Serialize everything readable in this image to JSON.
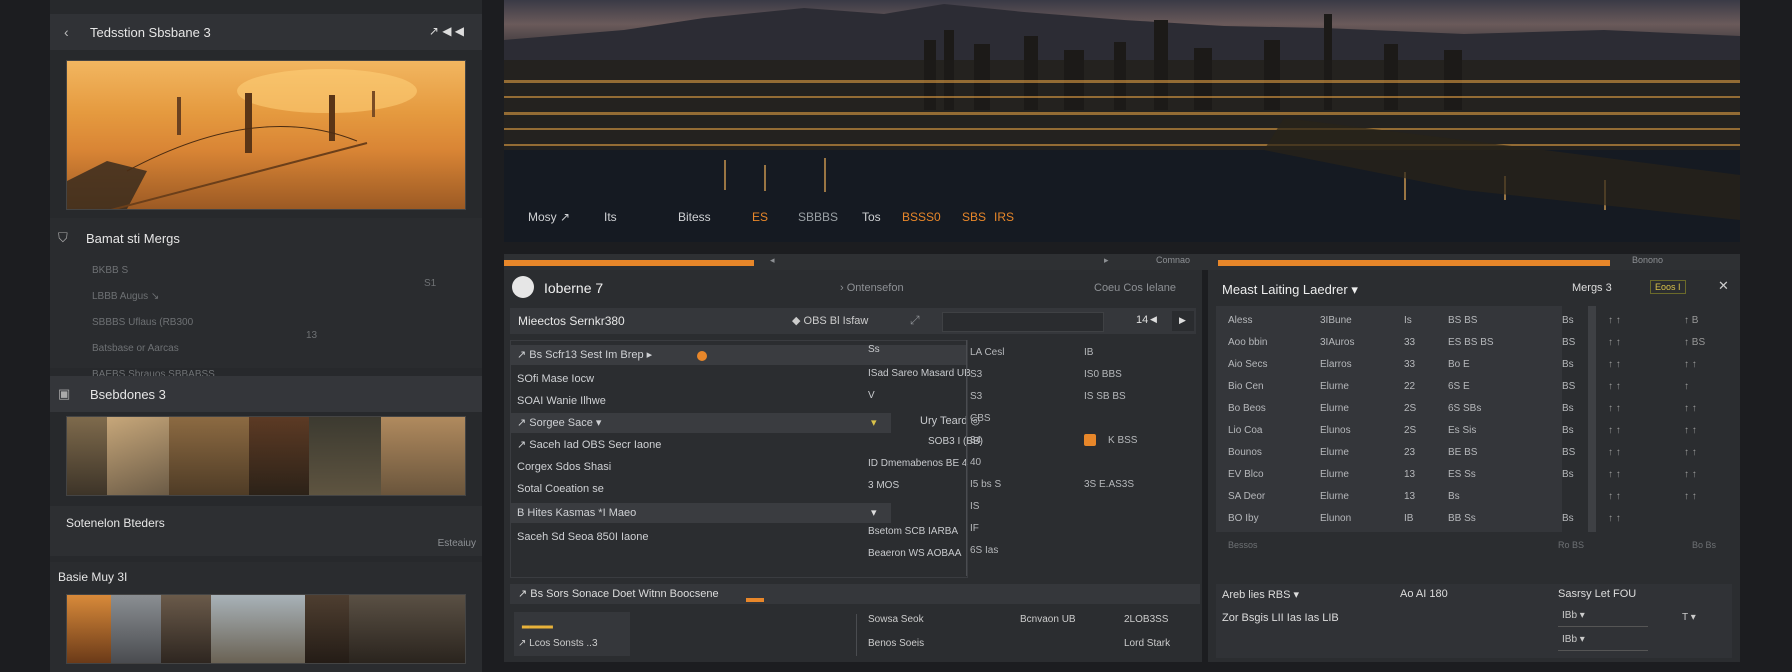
{
  "left": {
    "header1": "Tedsstion Sbsbane 3",
    "header1_icons": "↗ ◀ ◀",
    "section2_title": "Bamat sti Mergs",
    "section2_rows": [
      {
        "a": "BKBB  S",
        "b": ""
      },
      {
        "a": "LBBB Augus ↘",
        "b": "S                                           S1"
      },
      {
        "a": "SBBBS Uflaus (RB300",
        "b": ""
      },
      {
        "a": "Batsbase or Aarcas",
        "b": "13"
      },
      {
        "a": "BAEBS Sbrauos  SBBABSS",
        "b": ""
      }
    ],
    "section3_title": "Bsebdones 3",
    "section4_title": "Sotenelon Bteders",
    "section4_link": "Esteaiuy",
    "section5_title": "Basie Muy 3I"
  },
  "hero": {
    "labels": [
      {
        "text": "Mosy ↗",
        "color": "#e6e6e6"
      },
      {
        "text": "Its",
        "color": "#e6e6e6"
      },
      {
        "text": "Bitess",
        "color": "#e6e6e6"
      },
      {
        "text": "ES",
        "color": "#e8872a"
      },
      {
        "text": "SBBBS",
        "color": "#9aa0a4"
      },
      {
        "text": "Tos",
        "color": "#e6e6e6"
      },
      {
        "text": "BSSS0",
        "color": "#e8872a"
      },
      {
        "text": "SBS",
        "color": "#e8872a"
      },
      {
        "text": "IRS",
        "color": "#e8872a"
      }
    ],
    "bar_left": "◂",
    "bar_mid": "▸",
    "bar_right_a": "Comnao",
    "bar_right_b": "Bonono"
  },
  "mid": {
    "title": "Ioberne 7",
    "title_right_a": "› Ontensefon",
    "title_right_b": "Coeu  Cos Ielane",
    "toolbar_label": "Mieectos Sernkr380",
    "toolbar_mid": "◆ OBS  Bl Isfaw",
    "toolbar_icon": "⤢",
    "pager_num": "14",
    "rows": [
      {
        "left": "↗ Bs Scfr13  Sest Im Brep  ▸",
        "c2": "Ss",
        "c3": "LA  Ceal",
        "c4": "IB",
        "hl": true,
        "dot": true
      },
      {
        "left": "   SOfi Mase  Iocw",
        "c2": "ISad Sareo    Masard UB",
        "c3": "",
        "c4": "",
        "hl": false
      },
      {
        "left": "   SOAI Wanie  Ilhwe",
        "c2": "V",
        "c3": "",
        "c4": "",
        "hl": false
      },
      {
        "left": "↗ Sorgee Sace  ▾",
        "c2": "Ury  Teard  ◎",
        "c3": "",
        "c4": "",
        "hl": true
      },
      {
        "left": "↗ Saceh  Iad  OBS  Secr  Iaone",
        "c2": "SOB3 I  (BB)",
        "c3": "",
        "c4": "",
        "hl": false
      },
      {
        "left": "   Corgex Sdos Shasi",
        "c2": "ID Dmemabenos   BE  4",
        "c3": "",
        "c4": "",
        "hl": false
      },
      {
        "left": "   Sotal  Coeation se",
        "c2": "3  MOS",
        "c3": "",
        "c4": "",
        "hl": false
      },
      {
        "left": "B Hites Kasmas  *I Maeo",
        "c2": "",
        "c3": "",
        "c4": "",
        "hl": true
      },
      {
        "left": "   Saceh Sd Seoa 850I Iaone",
        "c2": "Bsetom     SCB IARBA",
        "c3": "",
        "c4": "",
        "hl": false
      },
      {
        "left": "",
        "c2": "Beaeron     WS  AOBAA",
        "c3": "",
        "c4": "",
        "hl": false
      }
    ],
    "col3": [
      "LA  Cesl",
      "S3",
      "S3",
      "CBS",
      "34",
      "40",
      "I5 bs  S",
      "IS",
      "IF",
      "6S  Ias"
    ],
    "col4": [
      "IB",
      "IS0  BBS",
      "IS  SB  BS",
      "",
      "",
      "",
      "3S  E.AS3S",
      "",
      "",
      ""
    ],
    "col4b": [
      "",
      "",
      "",
      "",
      "K BSS",
      "",
      "",
      "",
      "",
      ""
    ],
    "footer_row": "↗ Bs Sors Sonace  Doet  Witnn  Boocsene",
    "bottom_left_a": "▂▂▂▂",
    "bottom_left_b": "↗ Lcos Sonsts  ..3",
    "bottom_mid_a": "Sowsa  Seok",
    "bottom_mid_b": "Benos  Soeis",
    "bottom_right_a": "Bcnvaon  UB",
    "bottom_right_b": "Lord  Stark",
    "bottom_far_a": "2LOB3SS",
    "bottom_far_b": ""
  },
  "rightp": {
    "title": "Meast Laiting  Laedrer ▾",
    "title_right": "Mergs 3",
    "badge": "Eoos  I",
    "close": "✕",
    "tbl_c1": [
      "Aless",
      "Aoo bbin",
      "Aio Secs",
      "Bio Cen",
      "Bo Beos",
      "Lio Coa",
      "Bounos",
      "EV Blco",
      "SA Deor",
      "BO Iby"
    ],
    "tbl_c2": [
      "3IBune",
      "3IAuros",
      "Elarros",
      "Elurne",
      "Elurne",
      "Elunos",
      "Elurne",
      "Elurne",
      "Elurne",
      "Elunon"
    ],
    "tbl_c3": [
      "Is",
      "33",
      "33",
      "22",
      "2S",
      "2S",
      "23",
      "13",
      "13",
      "IB"
    ],
    "tbl_c4": [
      "BS  BS",
      "ES  BS  BS",
      "Bo  E",
      "6S  E",
      "6S  SBs",
      "Es  Sis",
      "BE  BS",
      "ES  Ss",
      "Bs",
      "BB  Ss"
    ],
    "tbl_c5": [
      "Bs",
      "BS",
      "Bs",
      "BS",
      "Bs",
      "Bs",
      "BS",
      "Bs",
      "",
      "Bs"
    ],
    "tbl_c6": [
      "↑  ↑",
      "↑  ↑",
      "↑  ↑",
      "↑  ↑",
      "↑  ↑",
      "↑  ↑",
      "↑  ↑",
      "↑  ↑",
      "↑  ↑",
      "↑  ↑"
    ],
    "tbl_c7": [
      "↑  B",
      "↑  BS",
      "↑  ↑",
      "↑",
      "↑  ↑",
      "↑  ↑",
      "↑  ↑",
      "↑  ↑",
      "↑  ↑",
      ""
    ],
    "strip_a": "Bessos",
    "strip_b": "Ro BS",
    "strip_c": "Bo  Bs",
    "bottom_a": "Areb lies  RBS  ▾",
    "bottom_b": "Ao  AI 180",
    "bottom_c": "Sasrsy  Let  FOU",
    "bottom_d": "Zor Bsgis  LII  Ias  Ias  LIB",
    "bottom_e": "IBb  ▾",
    "bottom_f": "T     ▾",
    "bottom_g": "IBb  ▾"
  }
}
